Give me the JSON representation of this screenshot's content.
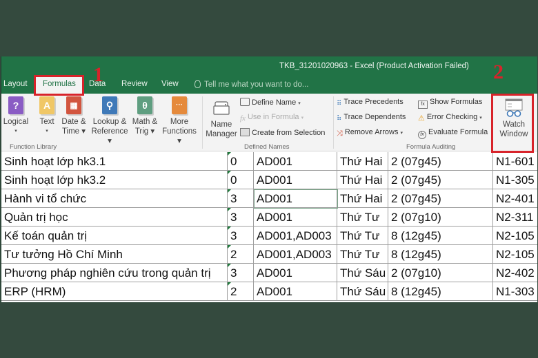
{
  "window": {
    "title": "TKB_31201020963 - Excel (Product Activation Failed)"
  },
  "tabs": [
    {
      "label": "Layout",
      "active": false
    },
    {
      "label": "Formulas",
      "active": true
    },
    {
      "label": "Data",
      "active": false
    },
    {
      "label": "Review",
      "active": false
    },
    {
      "label": "View",
      "active": false
    }
  ],
  "tell_me": {
    "placeholder": "Tell me what you want to do..."
  },
  "ribbon": {
    "function_library": {
      "label": "Function Library",
      "buttons": [
        {
          "line1": "Logical",
          "line2": "▾",
          "icon": "question-book-icon",
          "color": "#8a5cc4",
          "glyph": "?"
        },
        {
          "line1": "Text",
          "line2": "▾",
          "icon": "text-book-icon",
          "color": "#f0c766",
          "glyph": "A"
        },
        {
          "line1": "Date &",
          "line2": "Time ▾",
          "icon": "calendar-book-icon",
          "color": "#d2553f",
          "glyph": "▦"
        },
        {
          "line1": "Lookup &",
          "line2": "Reference ▾",
          "icon": "search-book-icon",
          "color": "#3f79b8",
          "glyph": "⚲"
        },
        {
          "line1": "Math &",
          "line2": "Trig ▾",
          "icon": "theta-book-icon",
          "color": "#5f9e80",
          "glyph": "θ"
        },
        {
          "line1": "More",
          "line2": "Functions ▾",
          "icon": "more-book-icon",
          "color": "#e58a3c",
          "glyph": "···"
        }
      ]
    },
    "defined_names": {
      "label": "Defined Names",
      "name_manager": {
        "line1": "Name",
        "line2": "Manager"
      },
      "define_name": "Define Name",
      "use_in_formula": "Use in Formula",
      "create_from_selection": "Create from Selection"
    },
    "formula_auditing": {
      "label": "Formula Auditing",
      "trace_precedents": "Trace Precedents",
      "trace_dependents": "Trace Dependents",
      "remove_arrows": "Remove Arrows",
      "show_formulas": "Show Formulas",
      "error_checking": "Error Checking",
      "evaluate_formula": "Evaluate Formula",
      "watch_window": {
        "line1": "Watch",
        "line2": "Window"
      }
    }
  },
  "annotations": {
    "step1": "1",
    "step2": "2",
    "color": "#d8232a"
  },
  "sheet": {
    "rows": [
      [
        "Sinh hoạt lớp hk3.1",
        "0",
        "AD001",
        "Thứ Hai",
        "2 (07g45)",
        "N1-601"
      ],
      [
        "Sinh hoạt lớp hk3.2",
        "0",
        "AD001",
        "Thứ Hai",
        "2 (07g45)",
        "N1-305"
      ],
      [
        "Hành vi tổ chức",
        "3",
        "AD001",
        "Thứ Hai",
        "2 (07g45)",
        "N2-401"
      ],
      [
        "Quản trị học",
        "3",
        "AD001",
        "Thứ Tư",
        "2 (07g10)",
        "N2-311"
      ],
      [
        "Kế toán quản trị",
        "3",
        "AD001,AD003",
        "Thứ Tư",
        "8 (12g45)",
        "N2-105"
      ],
      [
        "Tư tưởng Hồ Chí Minh",
        "2",
        "AD001,AD003",
        "Thứ Tư",
        "8 (12g45)",
        "N2-105"
      ],
      [
        "Phương pháp nghiên cứu trong quản trị",
        "3",
        "AD001",
        "Thứ Sáu",
        "2 (07g10)",
        "N2-402"
      ],
      [
        "ERP (HRM)",
        "2",
        "AD001",
        "Thứ Sáu",
        "8 (12g45)",
        "N1-303"
      ]
    ]
  }
}
